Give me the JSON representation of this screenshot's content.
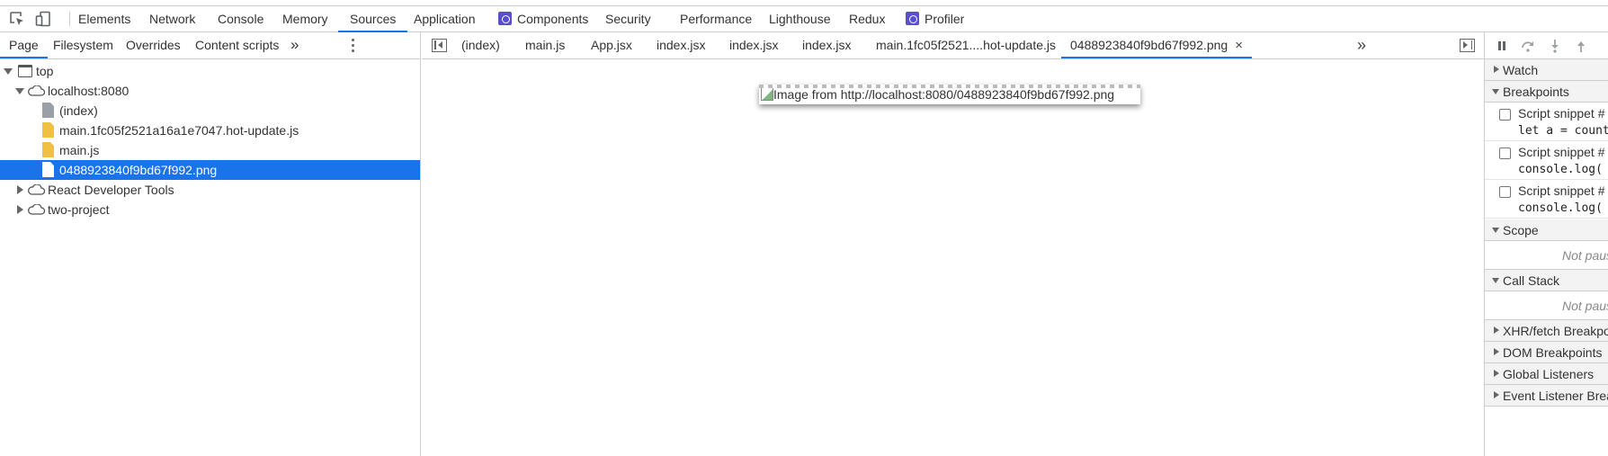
{
  "main_tabs": [
    {
      "label": "Elements"
    },
    {
      "label": "Network"
    },
    {
      "label": "Console"
    },
    {
      "label": "Memory"
    },
    {
      "label": "Sources",
      "active": true
    },
    {
      "label": "Application"
    },
    {
      "label": "Components",
      "icon": "react-extension-icon"
    },
    {
      "label": "Security"
    },
    {
      "label": "Performance"
    },
    {
      "label": "Lighthouse"
    },
    {
      "label": "Redux"
    },
    {
      "label": "Profiler",
      "icon": "react-extension-icon"
    }
  ],
  "navigator": {
    "tabs": [
      "Page",
      "Filesystem",
      "Overrides",
      "Content scripts"
    ],
    "more": "»",
    "tree": [
      {
        "label": "top",
        "icon": "frame-icon",
        "expanded": true
      },
      {
        "label": "localhost:8080",
        "icon": "cloud-icon",
        "expanded": true
      },
      {
        "label": "(index)",
        "icon": "document-file-icon"
      },
      {
        "label": "main.1fc05f2521a16a1e7047.hot-update.js",
        "icon": "script-file-icon"
      },
      {
        "label": "main.js",
        "icon": "script-file-icon"
      },
      {
        "label": "0488923840f9bd67f992.png",
        "icon": "image-file-icon",
        "selected": true
      },
      {
        "label": "React Developer Tools",
        "icon": "cloud-icon",
        "expanded": false
      },
      {
        "label": "two-project",
        "icon": "cloud-icon",
        "expanded": false
      }
    ]
  },
  "editor": {
    "tabs": [
      "(index)",
      "main.js",
      "App.jsx",
      "index.jsx",
      "index.jsx",
      "index.jsx",
      "main.1fc05f2521....hot-update.js",
      "0488923840f9bd67f992.png"
    ],
    "close": "×",
    "more": "»",
    "image_alt": "Image from http://localhost:8080/0488923840f9bd67f992.png"
  },
  "debugger": {
    "sections": {
      "watch": "Watch",
      "breakpoints": "Breakpoints",
      "scope": "Scope",
      "call_stack": "Call Stack",
      "xhr": "XHR/fetch Breakpoints",
      "dom": "DOM Breakpoints",
      "global": "Global Listeners",
      "event": "Event Listener Breakpoints"
    },
    "breakpoints": [
      {
        "title": "Script snippet #",
        "code": "let a = count"
      },
      {
        "title": "Script snippet #",
        "code": "console.log("
      },
      {
        "title": "Script snippet #",
        "code": "console.log("
      }
    ],
    "not_paused": "Not paused"
  },
  "colors": {
    "accent": "#1a73e8",
    "border": "#cacdd1",
    "extension": "#5a4fcf",
    "script_file": "#f0c043"
  }
}
